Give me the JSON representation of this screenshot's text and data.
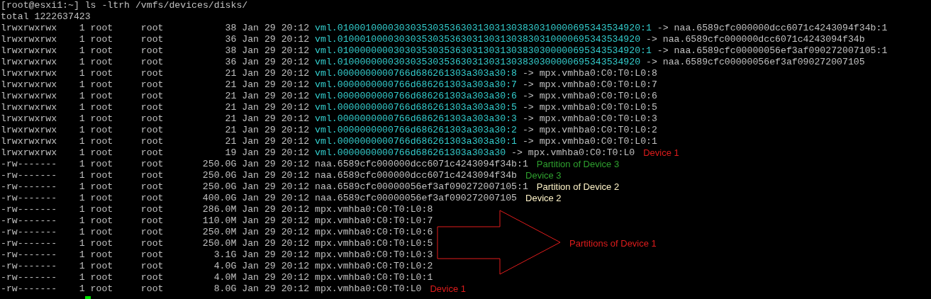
{
  "prompt": "[root@esxi1:~] ls -ltrh /vmfs/devices/disks/",
  "total": "total 1222637423",
  "rows": [
    {
      "kind": "link",
      "permissions": "lrwxrwxrwx",
      "links": "1",
      "owner": "root",
      "group": "root",
      "size": "38",
      "date": "Jan 29 20:12",
      "name": "vml.010001000030303530353630313031303830310000695343534920:1",
      "arrow": "->",
      "target": "naa.6589cfc000000dcc6071c4243094f34b:1"
    },
    {
      "kind": "link",
      "permissions": "lrwxrwxrwx",
      "links": "1",
      "owner": "root",
      "group": "root",
      "size": "36",
      "date": "Jan 29 20:12",
      "name": "vml.010001000030303530353630313031303830310000695343534920",
      "arrow": "->",
      "target": "naa.6589cfc000000dcc6071c4243094f34b"
    },
    {
      "kind": "link",
      "permissions": "lrwxrwxrwx",
      "links": "1",
      "owner": "root",
      "group": "root",
      "size": "38",
      "date": "Jan 29 20:12",
      "name": "vml.010000000030303530353630313031303830300000695343534920:1",
      "arrow": "->",
      "target": "naa.6589cfc00000056ef3af090272007105:1"
    },
    {
      "kind": "link",
      "permissions": "lrwxrwxrwx",
      "links": "1",
      "owner": "root",
      "group": "root",
      "size": "36",
      "date": "Jan 29 20:12",
      "name": "vml.010000000030303530353630313031303830300000695343534920",
      "arrow": "->",
      "target": "naa.6589cfc00000056ef3af090272007105"
    },
    {
      "kind": "link",
      "permissions": "lrwxrwxrwx",
      "links": "1",
      "owner": "root",
      "group": "root",
      "size": "21",
      "date": "Jan 29 20:12",
      "name": "vml.0000000000766d686261303a303a30:8",
      "arrow": "->",
      "target": "mpx.vmhba0:C0:T0:L0:8"
    },
    {
      "kind": "link",
      "permissions": "lrwxrwxrwx",
      "links": "1",
      "owner": "root",
      "group": "root",
      "size": "21",
      "date": "Jan 29 20:12",
      "name": "vml.0000000000766d686261303a303a30:7",
      "arrow": "->",
      "target": "mpx.vmhba0:C0:T0:L0:7"
    },
    {
      "kind": "link",
      "permissions": "lrwxrwxrwx",
      "links": "1",
      "owner": "root",
      "group": "root",
      "size": "21",
      "date": "Jan 29 20:12",
      "name": "vml.0000000000766d686261303a303a30:6",
      "arrow": "->",
      "target": "mpx.vmhba0:C0:T0:L0:6"
    },
    {
      "kind": "link",
      "permissions": "lrwxrwxrwx",
      "links": "1",
      "owner": "root",
      "group": "root",
      "size": "21",
      "date": "Jan 29 20:12",
      "name": "vml.0000000000766d686261303a303a30:5",
      "arrow": "->",
      "target": "mpx.vmhba0:C0:T0:L0:5"
    },
    {
      "kind": "link",
      "permissions": "lrwxrwxrwx",
      "links": "1",
      "owner": "root",
      "group": "root",
      "size": "21",
      "date": "Jan 29 20:12",
      "name": "vml.0000000000766d686261303a303a30:3",
      "arrow": "->",
      "target": "mpx.vmhba0:C0:T0:L0:3"
    },
    {
      "kind": "link",
      "permissions": "lrwxrwxrwx",
      "links": "1",
      "owner": "root",
      "group": "root",
      "size": "21",
      "date": "Jan 29 20:12",
      "name": "vml.0000000000766d686261303a303a30:2",
      "arrow": "->",
      "target": "mpx.vmhba0:C0:T0:L0:2"
    },
    {
      "kind": "link",
      "permissions": "lrwxrwxrwx",
      "links": "1",
      "owner": "root",
      "group": "root",
      "size": "21",
      "date": "Jan 29 20:12",
      "name": "vml.0000000000766d686261303a303a30:1",
      "arrow": "->",
      "target": "mpx.vmhba0:C0:T0:L0:1"
    },
    {
      "kind": "link",
      "permissions": "lrwxrwxrwx",
      "links": "1",
      "owner": "root",
      "group": "root",
      "size": "19",
      "date": "Jan 29 20:12",
      "name": "vml.0000000000766d686261303a303a30",
      "arrow": "->",
      "target": "mpx.vmhba0:C0:T0:L0",
      "note": {
        "text": "Device 1",
        "color": "#e01c1c"
      }
    },
    {
      "kind": "file",
      "permissions": "-rw-------",
      "links": "1",
      "owner": "root",
      "group": "root",
      "size": "250.0G",
      "date": "Jan 29 20:12",
      "name": "naa.6589cfc000000dcc6071c4243094f34b:1",
      "note": {
        "text": "Partition of Device 3",
        "color": "#2ea02e"
      }
    },
    {
      "kind": "file",
      "permissions": "-rw-------",
      "links": "1",
      "owner": "root",
      "group": "root",
      "size": "250.0G",
      "date": "Jan 29 20:12",
      "name": "naa.6589cfc000000dcc6071c4243094f34b",
      "note": {
        "text": "Device 3",
        "color": "#2ea02e"
      }
    },
    {
      "kind": "file",
      "permissions": "-rw-------",
      "links": "1",
      "owner": "root",
      "group": "root",
      "size": "250.0G",
      "date": "Jan 29 20:12",
      "name": "naa.6589cfc00000056ef3af090272007105:1",
      "note": {
        "text": "Partition of Device 2",
        "color": "#fff4c8"
      }
    },
    {
      "kind": "file",
      "permissions": "-rw-------",
      "links": "1",
      "owner": "root",
      "group": "root",
      "size": "400.0G",
      "date": "Jan 29 20:12",
      "name": "naa.6589cfc00000056ef3af090272007105",
      "note": {
        "text": "Device 2",
        "color": "#fff4c8"
      }
    },
    {
      "kind": "file",
      "permissions": "-rw-------",
      "links": "1",
      "owner": "root",
      "group": "root",
      "size": "286.0M",
      "date": "Jan 29 20:12",
      "name": "mpx.vmhba0:C0:T0:L0:8"
    },
    {
      "kind": "file",
      "permissions": "-rw-------",
      "links": "1",
      "owner": "root",
      "group": "root",
      "size": "110.0M",
      "date": "Jan 29 20:12",
      "name": "mpx.vmhba0:C0:T0:L0:7"
    },
    {
      "kind": "file",
      "permissions": "-rw-------",
      "links": "1",
      "owner": "root",
      "group": "root",
      "size": "250.0M",
      "date": "Jan 29 20:12",
      "name": "mpx.vmhba0:C0:T0:L0:6"
    },
    {
      "kind": "file",
      "permissions": "-rw-------",
      "links": "1",
      "owner": "root",
      "group": "root",
      "size": "250.0M",
      "date": "Jan 29 20:12",
      "name": "mpx.vmhba0:C0:T0:L0:5"
    },
    {
      "kind": "file",
      "permissions": "-rw-------",
      "links": "1",
      "owner": "root",
      "group": "root",
      "size": "3.1G",
      "date": "Jan 29 20:12",
      "name": "mpx.vmhba0:C0:T0:L0:3"
    },
    {
      "kind": "file",
      "permissions": "-rw-------",
      "links": "1",
      "owner": "root",
      "group": "root",
      "size": "4.0G",
      "date": "Jan 29 20:12",
      "name": "mpx.vmhba0:C0:T0:L0:2"
    },
    {
      "kind": "file",
      "permissions": "-rw-------",
      "links": "1",
      "owner": "root",
      "group": "root",
      "size": "4.0M",
      "date": "Jan 29 20:12",
      "name": "mpx.vmhba0:C0:T0:L0:1"
    },
    {
      "kind": "file",
      "permissions": "-rw-------",
      "links": "1",
      "owner": "root",
      "group": "root",
      "size": "8.0G",
      "date": "Jan 29 20:12",
      "name": "mpx.vmhba0:C0:T0:L0",
      "note": {
        "text": "Device 1",
        "color": "#e01c1c"
      }
    }
  ],
  "callout": {
    "text": "Partitions of Device 1",
    "color": "#e01c1c"
  }
}
